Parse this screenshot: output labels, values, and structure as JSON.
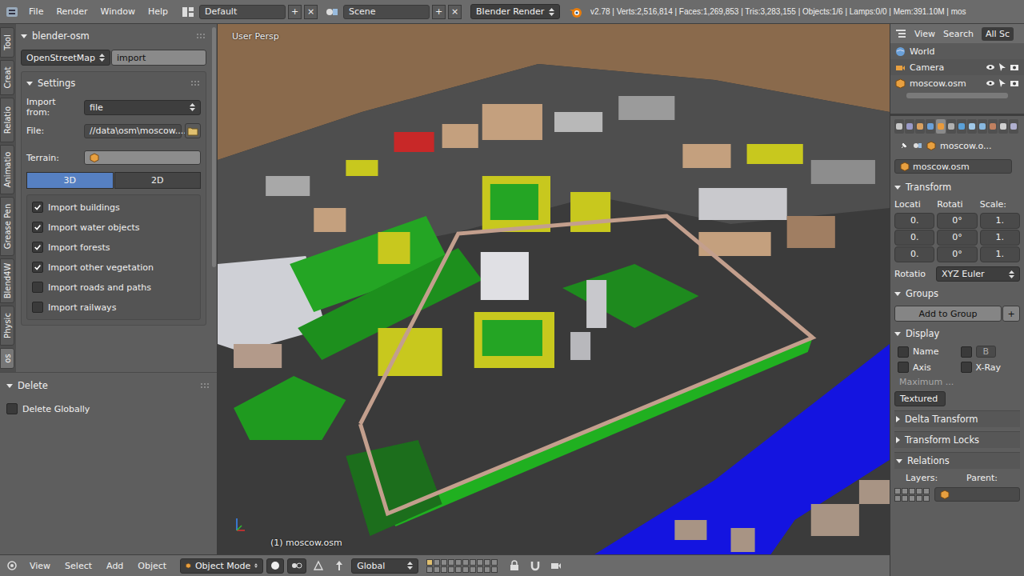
{
  "top_bar": {
    "menus": [
      "File",
      "Render",
      "Window",
      "Help"
    ],
    "layout": {
      "value": "Default",
      "buttons": [
        "+",
        "×"
      ]
    },
    "scene": {
      "value": "Scene",
      "buttons": [
        "+",
        "×"
      ]
    },
    "engine": "Blender Render",
    "stats": "v2.78 | Verts:2,516,814 | Faces:1,269,853 | Tris:3,283,155 | Objects:1/6 | Lamps:0/0 | Mem:391.10M | mos"
  },
  "tool_tabs": [
    {
      "label": "Tool",
      "selected": false
    },
    {
      "label": "Creat",
      "selected": false
    },
    {
      "label": "Relatio",
      "selected": false
    },
    {
      "label": "Animatio",
      "selected": false
    },
    {
      "label": "Grease Pen",
      "selected": false
    },
    {
      "label": "Blend4W",
      "selected": false
    },
    {
      "label": "Physic",
      "selected": false
    },
    {
      "label": "os",
      "selected": true
    }
  ],
  "addon_panel": {
    "title": "blender-osm",
    "expanded": true,
    "source": "OpenStreetMap",
    "action": "import",
    "settings": {
      "title": "Settings",
      "expanded": true,
      "import_from": {
        "label": "Import from:",
        "value": "file"
      },
      "file": {
        "label": "File:",
        "value": "//data\\osm\\moscow...."
      },
      "terrain": {
        "label": "Terrain:"
      },
      "modes": [
        {
          "label": "3D",
          "selected": true
        },
        {
          "label": "2D",
          "selected": false
        }
      ],
      "options": [
        {
          "label": "Import buildings",
          "checked": true
        },
        {
          "label": "Import water objects",
          "checked": true
        },
        {
          "label": "Import forests",
          "checked": true
        },
        {
          "label": "Import other vegetation",
          "checked": true
        },
        {
          "label": "Import roads and paths",
          "checked": false
        },
        {
          "label": "Import railways",
          "checked": false
        }
      ]
    }
  },
  "delete_panel": {
    "title": "Delete",
    "expanded": true,
    "options": [
      {
        "label": "Delete Globally",
        "checked": false
      }
    ]
  },
  "viewport": {
    "view_label": "User Persp",
    "object_label": "(1) moscow.osm"
  },
  "bottom_bar": {
    "menus": [
      "View",
      "Select",
      "Add",
      "Object"
    ],
    "mode": "Object Mode",
    "orientation": "Global"
  },
  "outliner": {
    "menus": [
      "View",
      "Search"
    ],
    "filter": {
      "label": "All Sc",
      "selected": true
    },
    "items": [
      {
        "label": "World",
        "kind": "world",
        "controls": false,
        "selected": false
      },
      {
        "label": "Camera",
        "kind": "camera",
        "controls": true,
        "selected": false
      },
      {
        "label": "moscow.osm",
        "kind": "mesh",
        "controls": true,
        "selected": false
      }
    ]
  },
  "properties": {
    "context_tabs": [
      {
        "selected": false
      },
      {
        "selected": false
      },
      {
        "selected": false
      },
      {
        "selected": false
      },
      {
        "selected": true
      },
      {
        "selected": false
      },
      {
        "selected": false
      },
      {
        "selected": false
      },
      {
        "selected": false
      },
      {
        "selected": false
      },
      {
        "selected": false
      },
      {
        "selected": false
      }
    ],
    "breadcrumb": "moscow.o...",
    "object_name": "moscow.osm",
    "transform": {
      "title": "Transform",
      "expanded": true,
      "columns": [
        {
          "label": "Locati",
          "values": [
            "0.",
            "0.",
            "0."
          ]
        },
        {
          "label": "Rotati",
          "values": [
            "0°",
            "0°",
            "0°"
          ]
        },
        {
          "label": "Scale:",
          "values": [
            "1.",
            "1.",
            "1."
          ]
        }
      ],
      "rotation_mode_label": "Rotatio",
      "rotation_mode": "XYZ Euler"
    },
    "groups": {
      "title": "Groups",
      "expanded": true,
      "button": "Add to Group",
      "add": "+"
    },
    "display": {
      "title": "Display",
      "expanded": true,
      "toggles": [
        {
          "label": "Name",
          "checked": false,
          "kind": "check"
        },
        {
          "label": "B",
          "checked": false,
          "kind": "field"
        },
        {
          "label": "Axis",
          "checked": false,
          "kind": "check"
        },
        {
          "label": "X-Ray",
          "checked": false,
          "kind": "check"
        }
      ],
      "max_draw": {
        "label": "Maximum ...",
        "disabled": true
      },
      "draw_type": "Textured"
    },
    "collapsed": [
      {
        "title": "Delta Transform",
        "expanded": false
      },
      {
        "title": "Transform Locks",
        "expanded": false
      }
    ],
    "relations": {
      "title": "Relations",
      "expanded": true,
      "labels": [
        "Layers:",
        "Parent:"
      ]
    }
  }
}
